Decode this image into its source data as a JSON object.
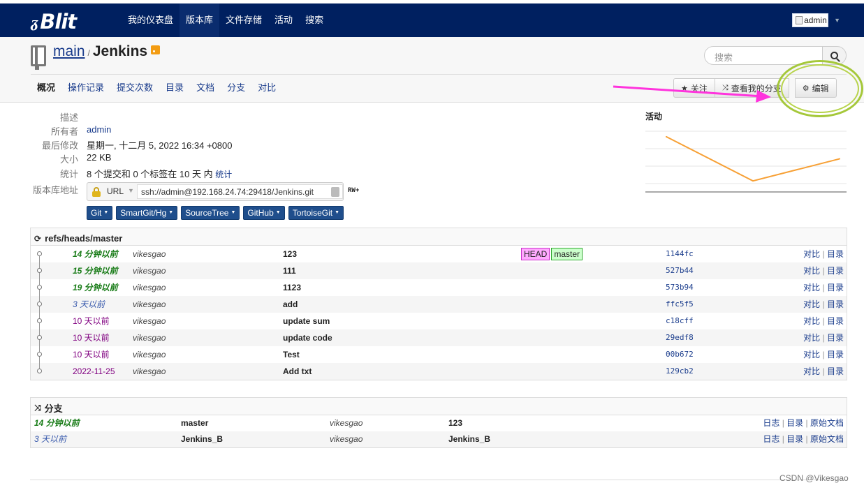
{
  "brand": {
    "mark": "ᵹ",
    "name": "Blit"
  },
  "nav": {
    "items": [
      "我的仪表盘",
      "版本库",
      "文件存储",
      "活动",
      "搜索"
    ],
    "active": "版本库",
    "user_alt": "admin"
  },
  "repo": {
    "project": "main",
    "separator": "/",
    "name": "Jenkins"
  },
  "search": {
    "placeholder": "搜索"
  },
  "tabs": [
    "概况",
    "操作记录",
    "提交次数",
    "目录",
    "文档",
    "分支",
    "对比"
  ],
  "actions": {
    "watch": "关注",
    "fork": "查看我的分支",
    "edit": "编辑"
  },
  "meta": {
    "description_label": "描述",
    "owner_label": "所有者",
    "owner": "admin",
    "last_change_label": "最后修改",
    "last_change": "星期一, 十二月 5, 2022 16:34 +0800",
    "size_label": "大小",
    "size": "22 KB",
    "stats_label": "统计",
    "stats": "8 个提交和 0 个标签在 10 天 内",
    "stats_link": "统计",
    "url_label": "版本库地址",
    "url_type": "URL",
    "url": "ssh://admin@192.168.24.74:29418/Jenkins.git",
    "permission": "RW+"
  },
  "clients": [
    "Git",
    "SmartGit/Hg",
    "SourceTree",
    "GitHub",
    "TortoiseGit"
  ],
  "activity": {
    "title": "活动",
    "color": "#f7a035"
  },
  "chart_data": {
    "type": "line",
    "title": "活动",
    "x": [
      1,
      2,
      3
    ],
    "values": [
      5,
      1,
      3
    ],
    "ylim": [
      0,
      5.5
    ]
  },
  "commits": {
    "ref": "refs/heads/master",
    "compare": "对比",
    "tree": "目录",
    "head_label": "HEAD",
    "branch_label": "master",
    "rows": [
      {
        "age": "14 分钟以前",
        "style": "bold",
        "author": "vikesgao",
        "message": "123",
        "sha": "1144fc",
        "refs": true
      },
      {
        "age": "15 分钟以前",
        "style": "bold",
        "author": "vikesgao",
        "message": "111",
        "sha": "527b44",
        "refs": false
      },
      {
        "age": "19 分钟以前",
        "style": "bold",
        "author": "vikesgao",
        "message": "1123",
        "sha": "573b94",
        "refs": false
      },
      {
        "age": "3 天以前",
        "style": "blue",
        "author": "vikesgao",
        "message": "add",
        "sha": "ffc5f5",
        "refs": false
      },
      {
        "age": "10 天以前",
        "style": "purple",
        "author": "vikesgao",
        "message": "update sum",
        "sha": "c18cff",
        "refs": false
      },
      {
        "age": "10 天以前",
        "style": "purple",
        "author": "vikesgao",
        "message": "update code",
        "sha": "29edf8",
        "refs": false
      },
      {
        "age": "10 天以前",
        "style": "purple",
        "author": "vikesgao",
        "message": "Test",
        "sha": "00b672",
        "refs": false
      },
      {
        "age": "2022-11-25",
        "style": "purple",
        "author": "vikesgao",
        "message": "Add txt",
        "sha": "129cb2",
        "refs": false
      }
    ]
  },
  "branches": {
    "title": "分支",
    "log": "日志",
    "tree": "目录",
    "docs": "原始文档",
    "rows": [
      {
        "age": "14 分钟以前",
        "style": "bold",
        "name": "master",
        "author": "vikesgao",
        "message": "123"
      },
      {
        "age": "3 天以前",
        "style": "blue",
        "name": "Jenkins_B",
        "author": "vikesgao",
        "message": "Jenkins_B"
      }
    ]
  },
  "watermark": "CSDN @Vikesgao",
  "annotation": {
    "arrow_color": "#ff33dd",
    "circle_color": "#a5c83a"
  }
}
